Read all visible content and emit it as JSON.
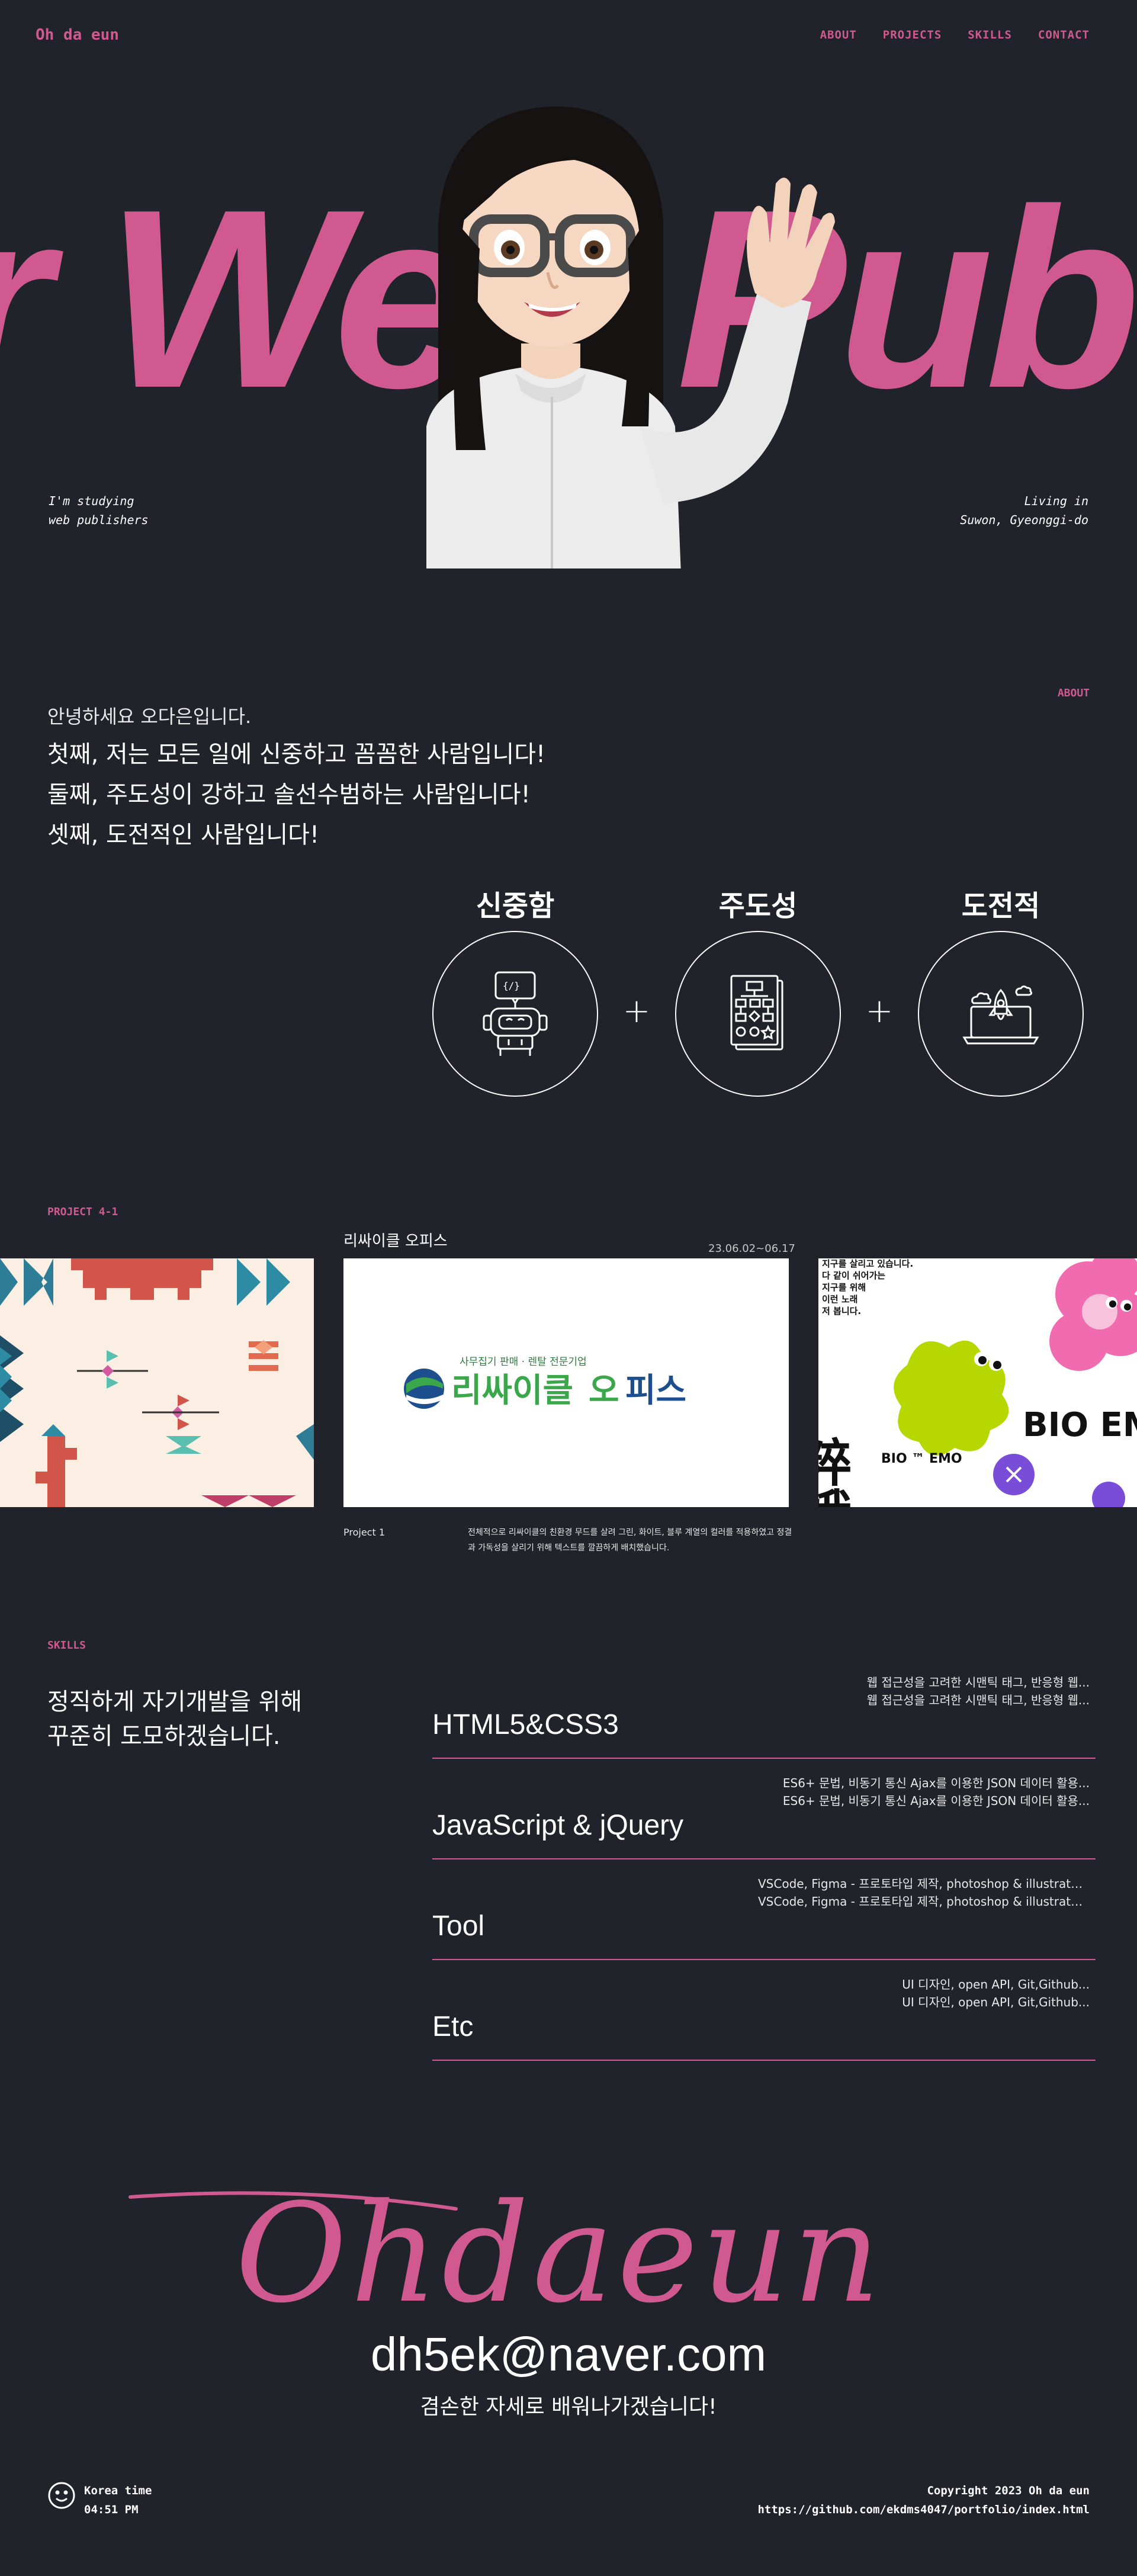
{
  "header": {
    "logo": "Oh da eun",
    "nav": [
      "ABOUT",
      "PROJECTS",
      "SKILLS",
      "CONTACT"
    ]
  },
  "hero": {
    "title": "r Web Publish",
    "left_line1": "I'm studying",
    "left_line2": "web publishers",
    "right_line1": "Living in",
    "right_line2": "Suwon, Gyeonggi-do"
  },
  "about": {
    "tag": "ABOUT",
    "intro": "안녕하세요 오다은입니다.",
    "lines": [
      "첫째, 저는 모든 일에 신중하고 꼼꼼한 사람입니다!",
      "둘째, 주도성이 강하고 솔선수범하는 사람입니다!",
      "셋째, 도전적인 사람입니다!"
    ],
    "traits": [
      "신중함",
      "주도성",
      "도전적"
    ],
    "trait_icons": [
      "robot-icon",
      "flowchart-icon",
      "rocket-laptop-icon"
    ],
    "plus": "+"
  },
  "projects": {
    "tag": "PROJECT 4-1",
    "name": "리싸이클 오피스",
    "date": "23.06.02~06.17",
    "number": "Project 1",
    "description": "전체적으로 리싸이클의 친환경 무드를 살려 그린, 화이트, 블루 계열의 컬러를 적용하였고 정결과 가독성을 살리기 위해 텍스트를 깔끔하게 배치했습니다.",
    "logo_tagline": "사무집기 판매 · 렌탈 전문기업",
    "logo_text_1": "리싸이클",
    "logo_text_2": "오",
    "logo_text_3": "피스",
    "right_poster_text": [
      "지구를 살리고 있습니다.",
      "다 같이 쉬어가는",
      "지구를 위해",
      "이런 노래",
      "저 봅니다."
    ],
    "right_poster_hanzi": "粹娥",
    "right_poster_small": "BIO ™ EMO",
    "right_poster_big": "BIO EMO"
  },
  "skills": {
    "tag": "SKILLS",
    "message_line1": "정직하게 자기개발을 위해",
    "message_line2": "꾸준히 도모하겠습니다.",
    "items": [
      {
        "name": "HTML5&CSS3",
        "desc": "웹 접근성을 고려한 시맨틱 태그, 반응형 웹..."
      },
      {
        "name": "JavaScript & jQuery",
        "desc": "ES6+ 문법, 비동기 통신 Ajax를 이용한 JSON 데이터 활용..."
      },
      {
        "name": "Tool",
        "desc": "VSCode, Figma - 프로토타입 제작, photoshop & illustrator..."
      },
      {
        "name": "Etc",
        "desc": "UI 디자인, open API, Git,Github..."
      }
    ]
  },
  "contact": {
    "signature": "Ohdaeun",
    "email": "dh5ek@naver.com",
    "message": "겸손한 자세로 배워나가겠습니다!"
  },
  "footer": {
    "clock_label": "Korea time",
    "clock_time": "04:51 PM",
    "copyright": "Copyright 2023 Oh da eun",
    "url": "https://github.com/ekdms4047/portfolio/index.html"
  },
  "colors": {
    "background": "#20232a",
    "accent": "#d0598f",
    "text": "#ffffff"
  }
}
